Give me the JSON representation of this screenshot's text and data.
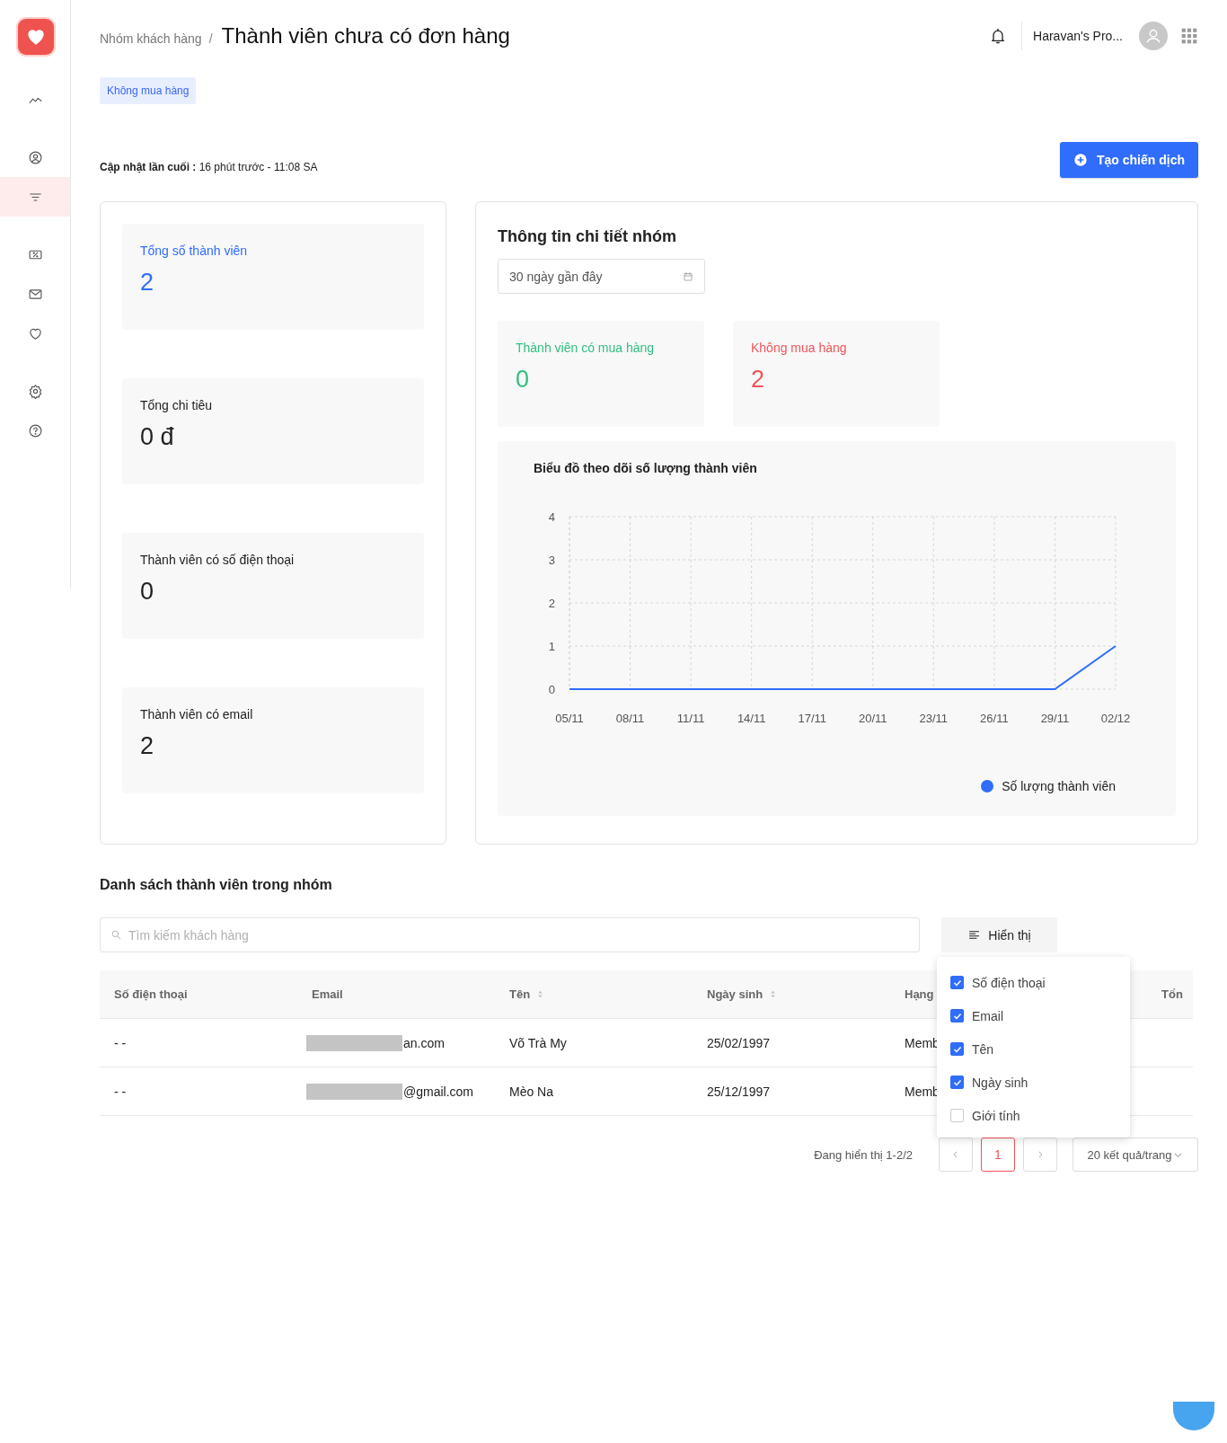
{
  "sidebar": {
    "items": [
      {
        "selected": false
      },
      {
        "selected": false
      },
      {
        "selected": true
      },
      {
        "selected": false
      },
      {
        "selected": false
      },
      {
        "selected": false
      },
      {
        "selected": false
      },
      {
        "selected": false
      }
    ]
  },
  "header": {
    "breadcrumb": "Nhóm khách hàng",
    "separator": "/",
    "title": "Thành viên chưa có đơn hàng",
    "account": "Haravan's Pro..."
  },
  "tag": "Không mua hàng",
  "last_update": {
    "label": "Cập nhật lần cuối :",
    "value": "16 phút trước - 11:08 SA"
  },
  "create_button": "Tạo chiến dịch",
  "summary_stats": [
    {
      "label": "Tổng số thành viên",
      "value": "2",
      "color": "#2f6dfa"
    },
    {
      "label": "Tổng chi tiêu",
      "value": "0 đ",
      "color": "#222222"
    },
    {
      "label": "Thành viên có số điện thoại",
      "value": "0",
      "color": "#222222"
    },
    {
      "label": "Thành viên có email",
      "value": "2",
      "color": "#222222"
    }
  ],
  "detail": {
    "title": "Thông tin chi tiết nhóm",
    "date_range": "30 ngày gần đây",
    "stats": [
      {
        "label": "Thành viên có mua hàng",
        "value": "0",
        "color": "#2fbf7f"
      },
      {
        "label": "Không mua hàng",
        "value": "2",
        "color": "#f0555a"
      }
    ],
    "chart": {
      "title": "Biểu đồ theo dõi số lượng thành viên",
      "chart_data": {
        "type": "line",
        "categories": [
          "05/11",
          "08/11",
          "11/11",
          "14/11",
          "17/11",
          "20/11",
          "23/11",
          "26/11",
          "29/11",
          "02/12"
        ],
        "series": [
          {
            "name": "Số lượng thành viên",
            "color": "#2f6dfa",
            "values": [
              0,
              0,
              0,
              0,
              0,
              0,
              0,
              0,
              0,
              1
            ]
          }
        ],
        "ylim": [
          0,
          4
        ],
        "yticks": [
          0,
          1,
          2,
          3,
          4
        ],
        "grid": true
      }
    }
  },
  "list": {
    "title": "Danh sách thành viên trong nhóm",
    "search": {
      "placeholder": "Tìm kiếm khách hàng"
    },
    "display_button": "Hiển thị",
    "columns": [
      {
        "label": "Số điện thoại",
        "sortable": false
      },
      {
        "label": "Email",
        "sortable": false
      },
      {
        "label": "Tên",
        "sortable": true
      },
      {
        "label": "Ngày sinh",
        "sortable": true
      },
      {
        "label": "Hạng"
      },
      {
        "label": "Tổn"
      }
    ],
    "rows": [
      {
        "phone": "- -",
        "email": "an.com",
        "name": "Võ Trà My",
        "birthday": "25/02/1997",
        "rank": "Memb"
      },
      {
        "phone": "- -",
        "email": "@gmail.com",
        "name": "Mèo Na",
        "birthday": "25/12/1997",
        "rank": "Memb"
      }
    ],
    "column_menu": [
      {
        "label": "Số điện thoại",
        "checked": true
      },
      {
        "label": "Email",
        "checked": true
      },
      {
        "label": "Tên",
        "checked": true
      },
      {
        "label": "Ngày sinh",
        "checked": true
      },
      {
        "label": "Giới tính",
        "checked": false
      }
    ],
    "pagination": {
      "summary": "Đang hiển thị 1-2/2",
      "pages": [
        {
          "label": "1",
          "selected": true
        }
      ],
      "page_size": "20 kết quả/trang"
    }
  }
}
